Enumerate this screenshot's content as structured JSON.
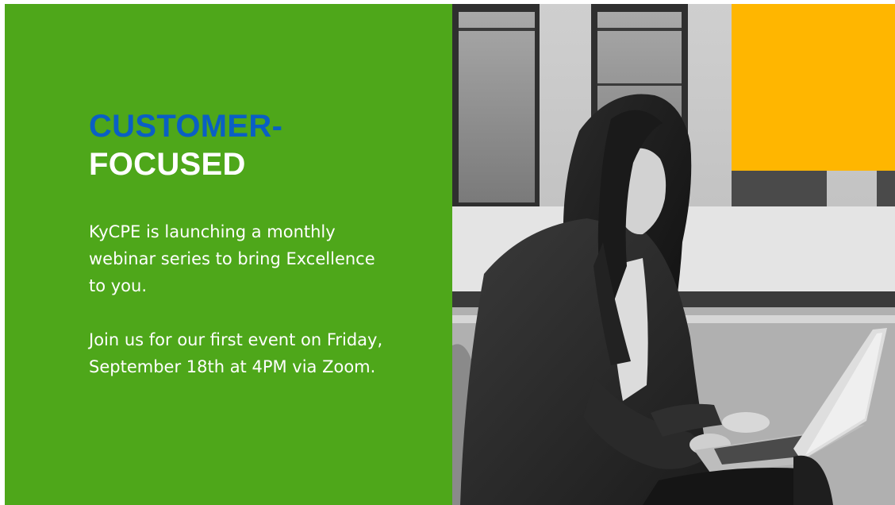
{
  "headline": {
    "line1": "CUSTOMER-",
    "line2": "FOCUSED"
  },
  "body": {
    "paragraph1": "KyCPE is launching a monthly webinar series to bring Excellence to you.",
    "paragraph2": "Join us for our first event on Friday, September 18th at 4PM via Zoom."
  },
  "colors": {
    "green_panel": "#4ea71a",
    "headline_blue": "#0a5fc4",
    "headline_white": "#ffffff",
    "accent_yellow": "#ffb600"
  },
  "photo": {
    "description_icon": "woman-working-on-laptop-photo"
  }
}
